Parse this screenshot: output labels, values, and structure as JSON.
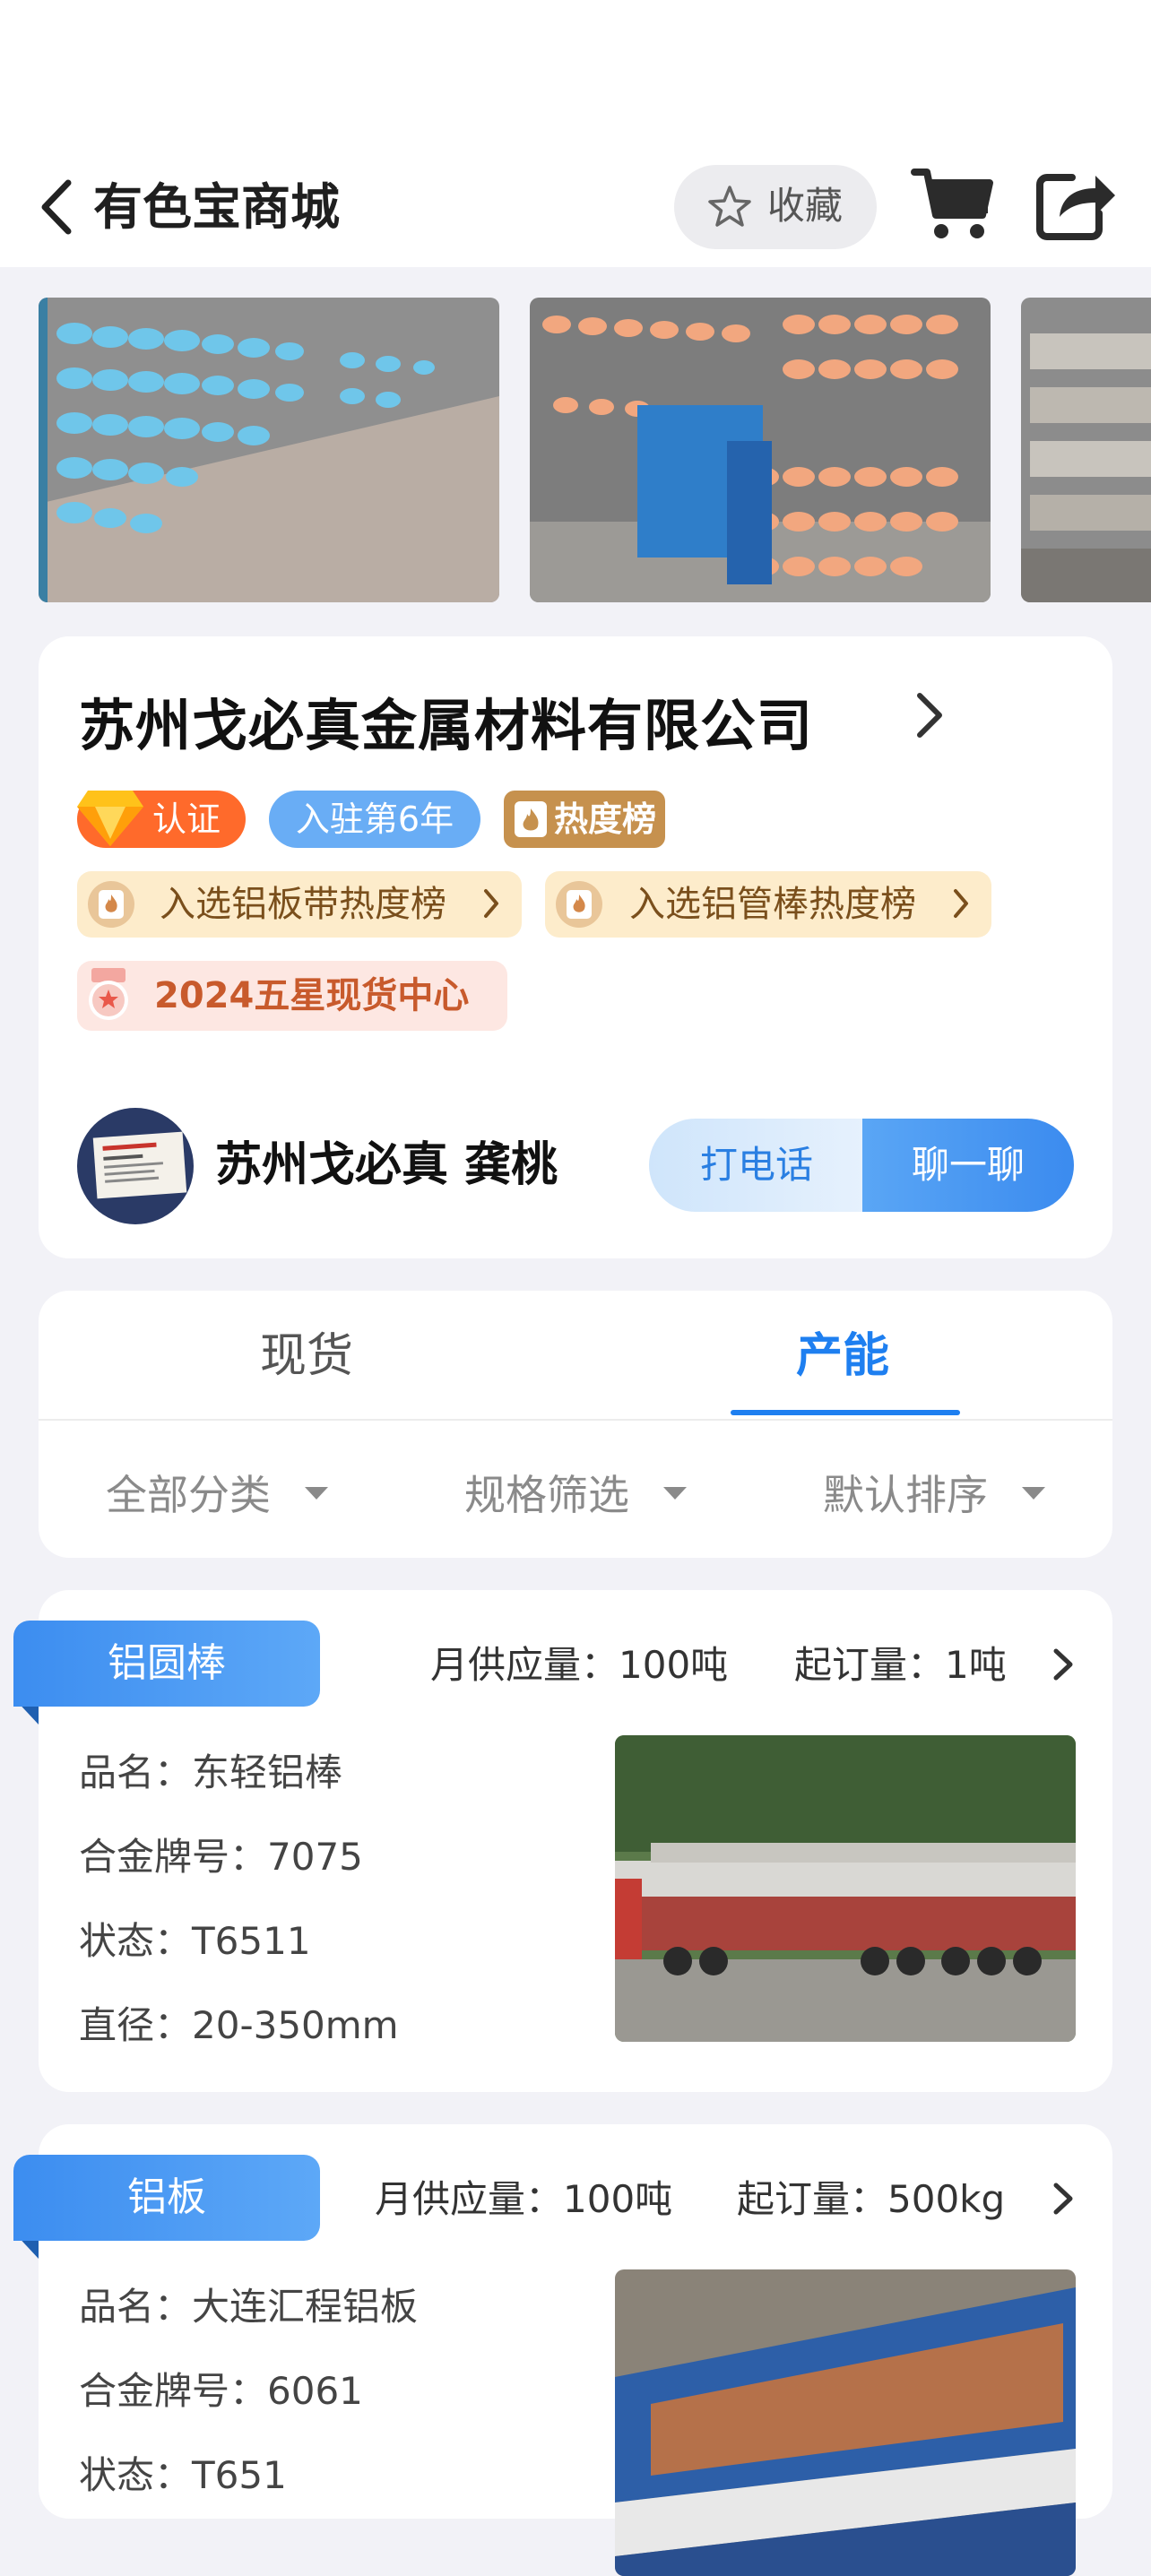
{
  "header": {
    "title": "有色宝商城",
    "favorite_label": "收藏"
  },
  "company": {
    "name": "苏州戈必真金属材料有限公司",
    "badges": {
      "certified": "认证",
      "years": "入驻第6年",
      "hot": "热度榜"
    },
    "rankings": [
      "入选铝板带热度榜",
      "入选铝管棒热度榜"
    ],
    "award": "2024五星现货中心",
    "contact_name": "苏州戈必真 龚桃",
    "call_label": "打电话",
    "chat_label": "聊一聊"
  },
  "tabs": {
    "items": [
      "现货",
      "产能"
    ],
    "active": "产能"
  },
  "filters": [
    "全部分类",
    "规格筛选",
    "默认排序"
  ],
  "products": [
    {
      "category": "铝圆棒",
      "supply": "月供应量：100吨",
      "min_order": "起订量：1吨",
      "specs": [
        "品名：东轻铝棒",
        "合金牌号：7075",
        "状态：T6511",
        "直径：20-350mm"
      ]
    },
    {
      "category": "铝板",
      "supply": "月供应量：100吨",
      "min_order": "起订量：500kg",
      "specs": [
        "品名：大连汇程铝板",
        "合金牌号：6061",
        "状态：T651"
      ]
    }
  ],
  "colors": {
    "accent": "#1e7ff0",
    "ribbon": "#3c8df0",
    "cert": "#ff6a2b",
    "hot": "#c6914e"
  }
}
